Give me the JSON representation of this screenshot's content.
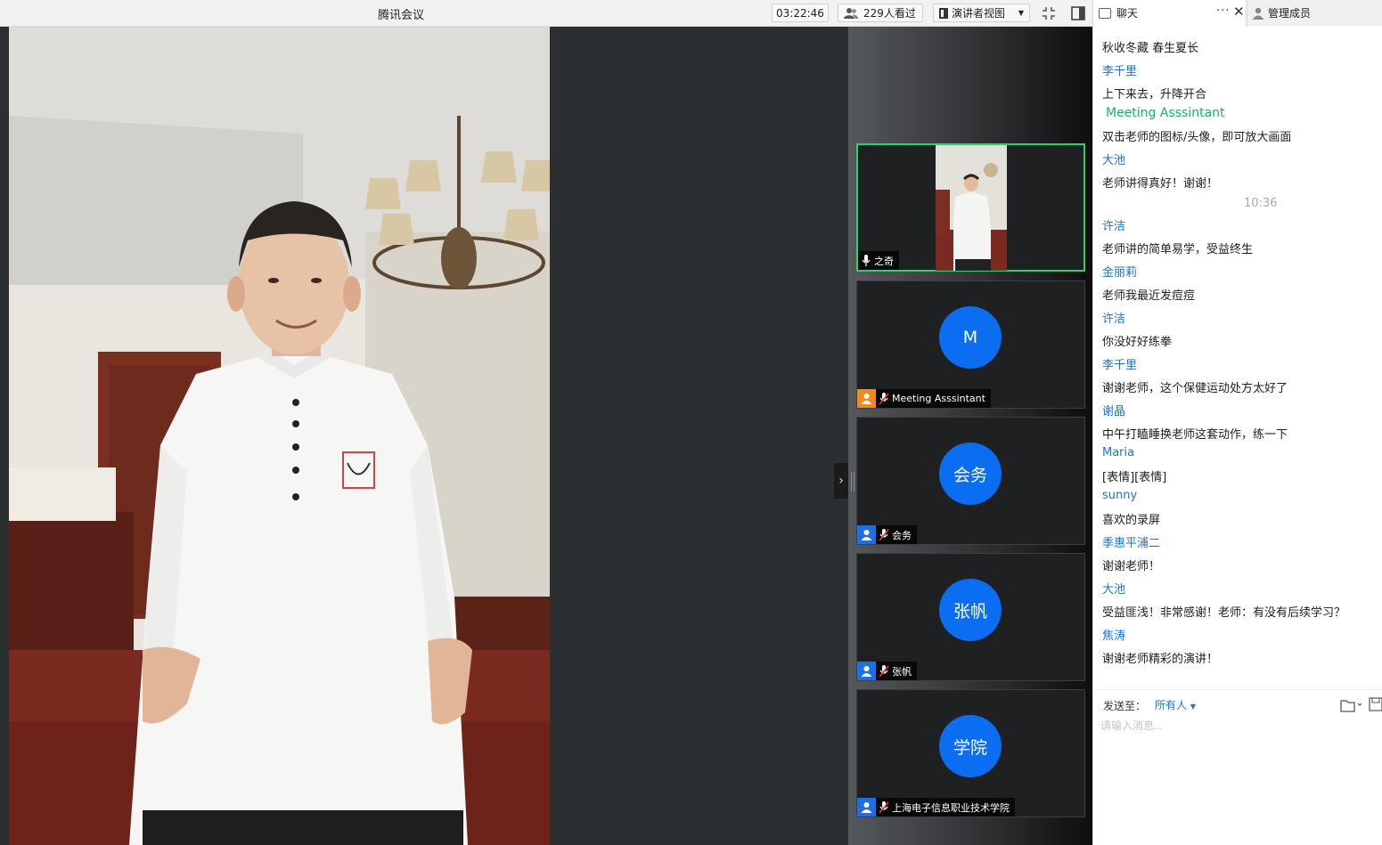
{
  "window": {
    "title": "腾讯会议"
  },
  "toolbar": {
    "timer": "03:22:46",
    "viewers": "229人看过",
    "view_mode": "演讲者视图"
  },
  "tiles": [
    {
      "name": "之奇",
      "type": "video",
      "active": true
    },
    {
      "name": "Meeting Asssintant",
      "initial": "M",
      "avatar_color": "orange"
    },
    {
      "name": "会务",
      "initial": "会务",
      "avatar_color": "blue"
    },
    {
      "name": "张帆",
      "initial": "张帆",
      "avatar_color": "blue"
    },
    {
      "name": "上海电子信息职业技术学院",
      "initial": "学院",
      "avatar_color": "blue"
    }
  ],
  "chat": {
    "tab_label": "聊天",
    "members_label": "管理成员",
    "messages": [
      {
        "kind": "text",
        "value": "秋收冬藏 春生夏长"
      },
      {
        "kind": "sender",
        "value": "李千里"
      },
      {
        "kind": "text",
        "value": "上下来去，升降开合"
      },
      {
        "kind": "sender-assistant",
        "value": "Meeting Asssintant"
      },
      {
        "kind": "text",
        "value": "双击老师的图标/头像，即可放大画面"
      },
      {
        "kind": "sender",
        "value": "大池"
      },
      {
        "kind": "text",
        "value": "老师讲得真好！谢谢！"
      },
      {
        "kind": "time",
        "value": "10:36"
      },
      {
        "kind": "sender",
        "value": "许洁"
      },
      {
        "kind": "text",
        "value": "老师讲的简单易学，受益终生"
      },
      {
        "kind": "sender",
        "value": "金丽莉"
      },
      {
        "kind": "text",
        "value": "老师我最近发痘痘"
      },
      {
        "kind": "sender",
        "value": "许洁"
      },
      {
        "kind": "text",
        "value": "你没好好练拳"
      },
      {
        "kind": "sender",
        "value": "李千里"
      },
      {
        "kind": "text",
        "value": "谢谢老师，这个保健运动处方太好了"
      },
      {
        "kind": "sender",
        "value": "谢晶"
      },
      {
        "kind": "text",
        "value": "中午打瞌睡换老师这套动作，练一下"
      },
      {
        "kind": "sender",
        "value": "Maria"
      },
      {
        "kind": "text",
        "value": "[表情][表情]"
      },
      {
        "kind": "sender",
        "value": "sunny"
      },
      {
        "kind": "text",
        "value": "喜欢的录屏"
      },
      {
        "kind": "sender",
        "value": "季惠平浦二"
      },
      {
        "kind": "text",
        "value": "谢谢老师！"
      },
      {
        "kind": "sender",
        "value": "大池"
      },
      {
        "kind": "text",
        "value": "受益匪浅！非常感谢！老师：有没有后续学习？"
      },
      {
        "kind": "sender",
        "value": "焦涛"
      },
      {
        "kind": "text",
        "value": "谢谢老师精彩的演讲！"
      }
    ],
    "send_to_label": "发送至：",
    "send_to_value": "所有人",
    "input_placeholder": "请输入消息..."
  },
  "colors": {
    "accent_blue": "#1a73d9",
    "avatar_blue": "#0a6df2",
    "assistant_green": "#18b35d",
    "active_border": "#2fd16a"
  }
}
